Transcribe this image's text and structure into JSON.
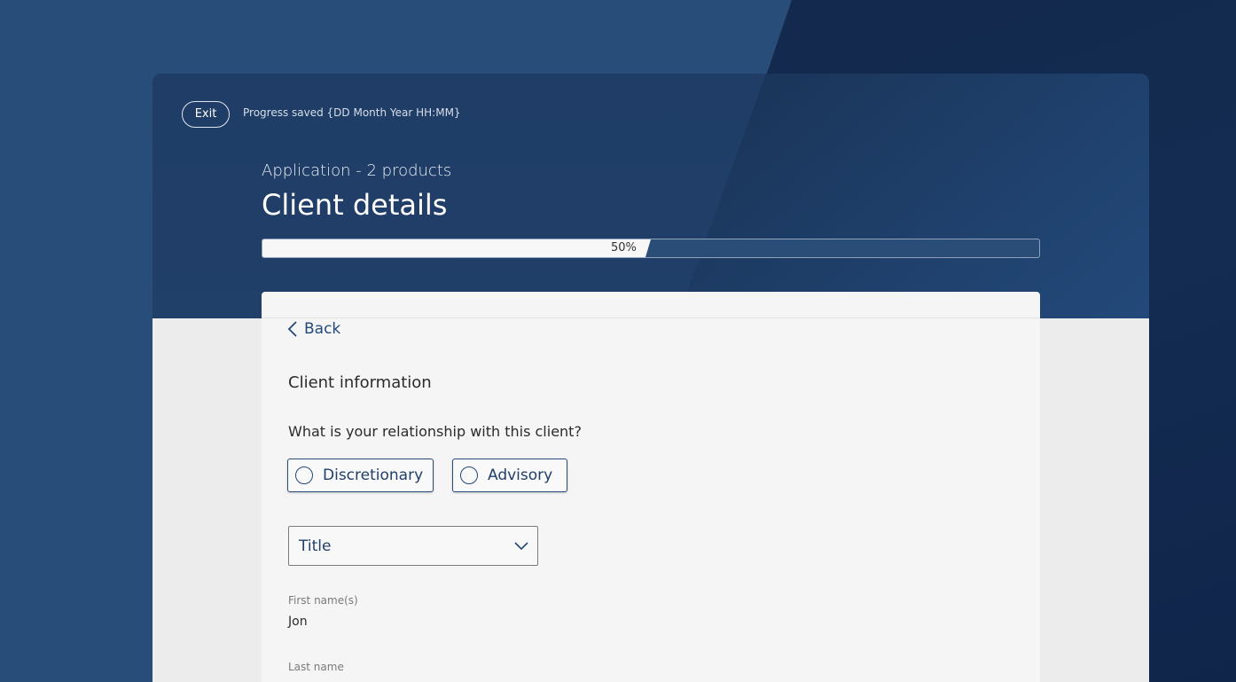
{
  "header": {
    "exit_label": "Exit",
    "progress_saved": "Progress saved {DD Month Year HH:MM}",
    "subtitle": "Application - 2 products",
    "title": "Client details"
  },
  "progress": {
    "percent": 50,
    "label": "50%"
  },
  "form": {
    "back_label": "Back",
    "section_title": "Client information",
    "relationship_question": "What is your relationship with this client?",
    "relationship_options": [
      "Discretionary",
      "Advisory"
    ],
    "title_select": {
      "label": "Title",
      "icon": "chevron-down-icon"
    },
    "first_name": {
      "label": "First name(s)",
      "value": "Jon"
    },
    "last_name": {
      "label": "Last name"
    }
  },
  "colors": {
    "brand_navy": "#23497a",
    "background_dark": "#12284a",
    "background_mid": "#284d78",
    "card": "#f5f5f5"
  }
}
